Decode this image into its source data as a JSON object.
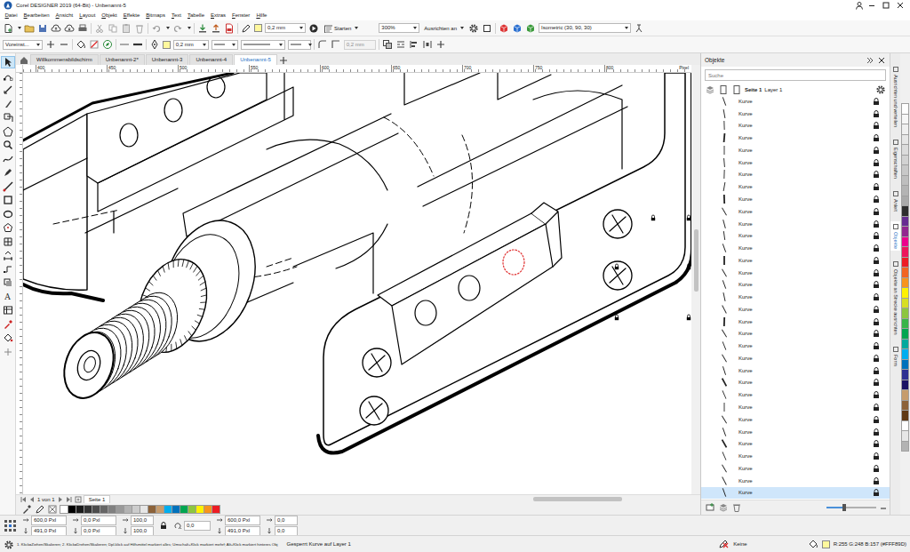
{
  "window": {
    "title": "Corel DESIGNER 2019 (64-Bit) - Unbenannt-5"
  },
  "menu": [
    "Datei",
    "Bearbeiten",
    "Ansicht",
    "Layout",
    "Objekt",
    "Effekte",
    "Bitmaps",
    "Text",
    "Tabelle",
    "Extras",
    "Fenster",
    "Hilfe"
  ],
  "toolbar": {
    "outline_width": "0,2 mm",
    "launch": "Starten",
    "zoom": "300%",
    "snap": "Ausrichten an",
    "grid": "Isometric (30, 90, 30)"
  },
  "property_bar": {
    "preset": "Voreinst...",
    "outline_width": "0,2 mm",
    "corner_radius": {
      "value": "0,2 mm",
      "disabled": true
    }
  },
  "doc_tabs": [
    {
      "label": "Willkommensbildschirm",
      "selected": false
    },
    {
      "label": "Unbenannt-2*",
      "selected": false
    },
    {
      "label": "Unbenannt-3",
      "selected": false
    },
    {
      "label": "Unbenannt-4",
      "selected": false
    },
    {
      "label": "Unbenannt-5",
      "selected": true
    }
  ],
  "tools": [
    {
      "selected": true
    },
    {
      "selected": false
    },
    {
      "selected": false
    },
    {
      "selected": false
    },
    {
      "selected": false
    },
    {
      "selected": false
    },
    {
      "selected": false
    },
    {
      "selected": false
    },
    {
      "selected": false
    },
    {
      "selected": false
    },
    {
      "selected": false
    },
    {
      "selected": false
    },
    {
      "selected": false
    },
    {
      "selected": false
    },
    {
      "selected": false
    },
    {
      "selected": false
    },
    {
      "selected": false
    },
    {
      "selected": false,
      "glyph": "A"
    },
    {
      "selected": false
    },
    {
      "selected": false
    },
    {
      "selected": false
    },
    {
      "selected": false
    }
  ],
  "ruler": {
    "ticks": [
      "400",
      "450",
      "500",
      "550",
      "600",
      "650",
      "700",
      "750",
      "800"
    ],
    "unit": "Pixel"
  },
  "page_nav": {
    "counter": "1 von 1",
    "page": "Seite 1"
  },
  "bottom_palette": [
    {
      "color": "#ffffff"
    },
    {
      "color": "#000000"
    },
    {
      "color": "#1a1a1a"
    },
    {
      "color": "#333333"
    },
    {
      "color": "#4d4d4d"
    },
    {
      "color": "#666666"
    },
    {
      "color": "#808080"
    },
    {
      "color": "#999999"
    },
    {
      "color": "#b3b3b3"
    },
    {
      "color": "#cccccc"
    },
    {
      "color": "#e6e6e6"
    },
    {
      "color": "#8c6239"
    },
    {
      "color": "#c69c6d"
    },
    {
      "color": "#00aeef"
    },
    {
      "color": "#0072bc"
    },
    {
      "color": "#00a651"
    },
    {
      "color": "#8dc63f"
    },
    {
      "color": "#fff200"
    },
    {
      "color": "#f7941d"
    },
    {
      "color": "#ed1c24"
    }
  ],
  "side_palette": [
    {
      "color": "#ffffff"
    },
    {
      "color": "#f7f7f7"
    },
    {
      "color": "#f0f0f0"
    },
    {
      "color": "#e6e6e6"
    },
    {
      "color": "#dcdcdc"
    },
    {
      "color": "#d2d2d2"
    },
    {
      "color": "#c8c8c8"
    },
    {
      "color": "#bebebe"
    },
    {
      "color": "#b4b4b4"
    },
    {
      "color": "#aaaaaa"
    },
    {
      "color": "#2e2e2e"
    },
    {
      "color": "#662d91"
    },
    {
      "color": "#92278f"
    },
    {
      "color": "#ec008c"
    },
    {
      "color": "#ed145b"
    },
    {
      "color": "#ed1c24"
    },
    {
      "color": "#f26522"
    },
    {
      "color": "#f7941d"
    },
    {
      "color": "#fff200"
    },
    {
      "color": "#d7df23"
    },
    {
      "color": "#8dc63f"
    },
    {
      "color": "#39b54a"
    },
    {
      "color": "#00a651"
    },
    {
      "color": "#00a99d"
    },
    {
      "color": "#00aeef"
    },
    {
      "color": "#0072bc"
    },
    {
      "color": "#2e3192"
    },
    {
      "color": "#1b1464"
    },
    {
      "color": "#c69c6d"
    },
    {
      "color": "#8c6239"
    },
    {
      "color": "#603913"
    },
    {
      "color": "#ffffff"
    },
    {
      "color": "#e6e6e6"
    },
    {
      "color": "#b3b3b3"
    }
  ],
  "status_line": {
    "pos_x": "600,0 Pxl",
    "pos_y": "491,0 Pxl",
    "size_w": "0,0 Pxl",
    "size_h": "0,0 Pxl",
    "scale_x": "100,0",
    "scale_y": "100,0",
    "angle": "0,0",
    "center_x": "600,0 Pxl",
    "center_y": "491,0 Pxl",
    "skew_x": "0,0",
    "skew_y": "0,0"
  },
  "status_bar": {
    "hint": "1. Klick=Ziehen/Skalieren; 2. Klick=Drehen/Skalieren; Dpl-klick auf Hilfsmittel markiert alles; Umschalt+Klick markiert mehrf; Alt+Klick markiert hinteres Obj",
    "selection": "Gesperrt Kurve auf Layer 1",
    "outline": "Keine",
    "fill": "R:255 G:248 B:157 (#FFF89D)"
  },
  "docker": {
    "title": "Objekte",
    "search": {
      "placeholder": "Suche"
    },
    "page": "Seite 1",
    "layer": "Layer 1",
    "thumb_size": {
      "level": 0.35
    },
    "items": [
      {
        "label": "Kurve",
        "locked": true,
        "selected": false
      },
      {
        "label": "Kurve",
        "locked": true,
        "selected": false
      },
      {
        "label": "Kurve",
        "locked": true,
        "selected": false
      },
      {
        "label": "Kurve",
        "locked": true,
        "selected": false
      },
      {
        "label": "Kurve",
        "locked": true,
        "selected": false
      },
      {
        "label": "Kurve",
        "locked": true,
        "selected": false
      },
      {
        "label": "Kurve",
        "locked": true,
        "selected": false
      },
      {
        "label": "Kurve",
        "locked": true,
        "selected": false
      },
      {
        "label": "Kurve",
        "locked": true,
        "selected": false
      },
      {
        "label": "Kurve",
        "locked": true,
        "selected": false
      },
      {
        "label": "Kurve",
        "locked": true,
        "selected": false
      },
      {
        "label": "Kurve",
        "locked": true,
        "selected": false
      },
      {
        "label": "Kurve",
        "locked": true,
        "selected": false
      },
      {
        "label": "Kurve",
        "locked": true,
        "selected": false
      },
      {
        "label": "Kurve",
        "locked": true,
        "selected": false
      },
      {
        "label": "Kurve",
        "locked": true,
        "selected": false
      },
      {
        "label": "Kurve",
        "locked": true,
        "selected": false
      },
      {
        "label": "Kurve",
        "locked": true,
        "selected": false
      },
      {
        "label": "Kurve",
        "locked": true,
        "selected": false
      },
      {
        "label": "Kurve",
        "locked": true,
        "selected": false
      },
      {
        "label": "Kurve",
        "locked": true,
        "selected": false
      },
      {
        "label": "Kurve",
        "locked": true,
        "selected": false
      },
      {
        "label": "Kurve",
        "locked": true,
        "selected": false
      },
      {
        "label": "Kurve",
        "locked": true,
        "selected": false
      },
      {
        "label": "Kurve",
        "locked": true,
        "selected": false
      },
      {
        "label": "Kurve",
        "locked": true,
        "selected": false
      },
      {
        "label": "Kurve",
        "locked": true,
        "selected": false
      },
      {
        "label": "Kurve",
        "locked": true,
        "selected": false
      },
      {
        "label": "Kurve",
        "locked": true,
        "selected": false
      },
      {
        "label": "Kurve",
        "locked": true,
        "selected": false
      },
      {
        "label": "Kurve",
        "locked": true,
        "selected": false
      },
      {
        "label": "Kurve",
        "locked": true,
        "selected": false
      },
      {
        "label": "Kurve",
        "locked": true,
        "selected": true
      }
    ]
  },
  "side_tabs": [
    {
      "label": "Ausrichten und verteilen",
      "selected": false
    },
    {
      "label": "Eigenschaften",
      "selected": false
    },
    {
      "label": "Anleit",
      "selected": false
    },
    {
      "label": "Objekte",
      "selected": true
    },
    {
      "label": "Objekte an Strecke ausrichten",
      "selected": false
    },
    {
      "label": "Form",
      "selected": false
    }
  ]
}
